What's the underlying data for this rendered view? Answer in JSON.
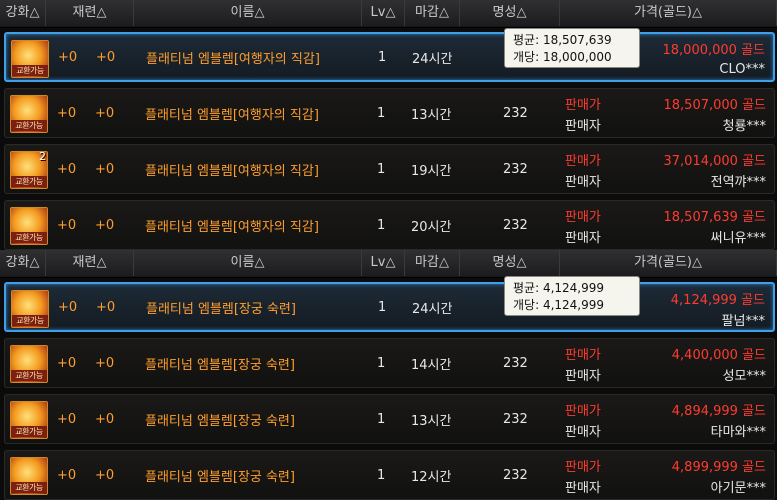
{
  "header": {
    "col_enhance": "강화△",
    "col_refine": "재련△",
    "col_name": "이름△",
    "col_lv": "Lv△",
    "col_deadline": "마감△",
    "col_fame": "명성△",
    "col_price": "가격(골드)△"
  },
  "icon_tag": "교환가능",
  "seller_label": "판매가",
  "seller_name_label": "판매자",
  "groups": [
    {
      "tooltip": {
        "avg_label": "평균:",
        "avg": "18,507,639",
        "unit_label": "개당:",
        "unit": "18,000,000"
      },
      "rows": [
        {
          "enhance": "+0",
          "refine": "+0",
          "name": "플래티넘 엠블렘[여행자의 직감]",
          "lv": "1",
          "time": "24시간",
          "fame": "",
          "price": "18,000,000 골드",
          "seller": "CLO***",
          "count": ""
        },
        {
          "enhance": "+0",
          "refine": "+0",
          "name": "플래티넘 엠블렘[여행자의 직감]",
          "lv": "1",
          "time": "13시간",
          "fame": "232",
          "price": "18,507,000 골드",
          "seller": "청룡***",
          "count": ""
        },
        {
          "enhance": "+0",
          "refine": "+0",
          "name": "플래티넘 엠블렘[여행자의 직감]",
          "lv": "1",
          "time": "19시간",
          "fame": "232",
          "price": "37,014,000 골드",
          "seller": "전역꺄***",
          "count": "2"
        },
        {
          "enhance": "+0",
          "refine": "+0",
          "name": "플래티넘 엠블렘[여행자의 직감]",
          "lv": "1",
          "time": "20시간",
          "fame": "232",
          "price": "18,507,639 골드",
          "seller": "써니유***",
          "count": ""
        }
      ]
    },
    {
      "tooltip": {
        "avg_label": "평균:",
        "avg": "4,124,999",
        "unit_label": "개당:",
        "unit": "4,124,999"
      },
      "rows": [
        {
          "enhance": "+0",
          "refine": "+0",
          "name": "플래티넘 엠블렘[장궁 숙련]",
          "lv": "1",
          "time": "24시간",
          "fame": "",
          "price": "4,124,999 골드",
          "seller": "팔넘***",
          "count": ""
        },
        {
          "enhance": "+0",
          "refine": "+0",
          "name": "플래티넘 엠블렘[장궁 숙련]",
          "lv": "1",
          "time": "14시간",
          "fame": "232",
          "price": "4,400,000 골드",
          "seller": "성모***",
          "count": ""
        },
        {
          "enhance": "+0",
          "refine": "+0",
          "name": "플래티넘 엠블렘[장궁 숙련]",
          "lv": "1",
          "time": "13시간",
          "fame": "232",
          "price": "4,894,999 골드",
          "seller": "타마와***",
          "count": ""
        },
        {
          "enhance": "+0",
          "refine": "+0",
          "name": "플래티넘 엠블렘[장궁 숙련]",
          "lv": "1",
          "time": "12시간",
          "fame": "232",
          "price": "4,899,999 골드",
          "seller": "아기문***",
          "count": ""
        }
      ]
    }
  ]
}
